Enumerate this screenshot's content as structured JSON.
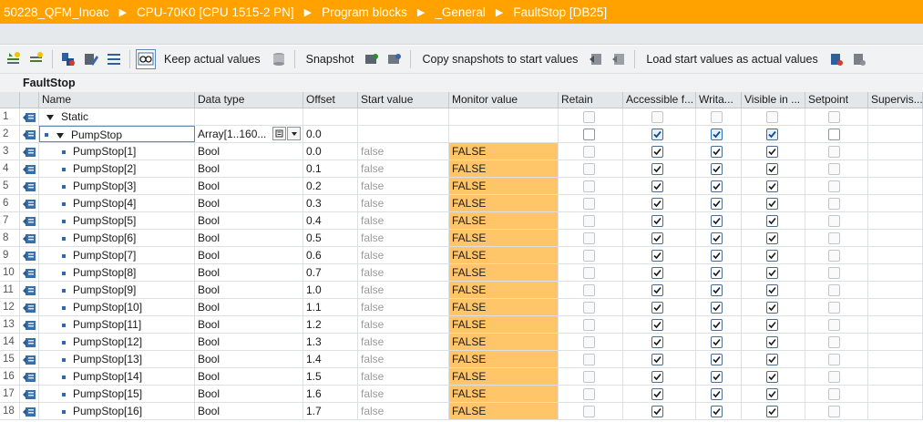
{
  "breadcrumb": [
    "50228_QFM_Inoac",
    "CPU-70K0 [CPU 1515-2 PN]",
    "Program blocks",
    "_General",
    "FaultStop [DB25]"
  ],
  "toolbar": {
    "keep_label": "Keep actual values",
    "snapshot_label": "Snapshot",
    "copy_label": "Copy snapshots to start values",
    "load_label": "Load start values as actual values"
  },
  "block_title": "FaultStop",
  "columns": {
    "name": "Name",
    "type": "Data type",
    "offset": "Offset",
    "start": "Start value",
    "monitor": "Monitor value",
    "retain": "Retain",
    "accessible": "Accessible f...",
    "writable": "Writa...",
    "visible": "Visible in ...",
    "setpoint": "Setpoint",
    "supervision": "Supervis..."
  },
  "rows": [
    {
      "n": "1",
      "name": "Static",
      "type": "",
      "offset": "",
      "start": "",
      "monitor": ""
    },
    {
      "n": "2",
      "name": "PumpStop",
      "type": "Array[1..160...",
      "offset": "0.0",
      "start": "",
      "monitor": ""
    },
    {
      "n": "3",
      "name": "PumpStop[1]",
      "type": "Bool",
      "offset": "0.0",
      "start": "false",
      "monitor": "FALSE"
    },
    {
      "n": "4",
      "name": "PumpStop[2]",
      "type": "Bool",
      "offset": "0.1",
      "start": "false",
      "monitor": "FALSE"
    },
    {
      "n": "5",
      "name": "PumpStop[3]",
      "type": "Bool",
      "offset": "0.2",
      "start": "false",
      "monitor": "FALSE"
    },
    {
      "n": "6",
      "name": "PumpStop[4]",
      "type": "Bool",
      "offset": "0.3",
      "start": "false",
      "monitor": "FALSE"
    },
    {
      "n": "7",
      "name": "PumpStop[5]",
      "type": "Bool",
      "offset": "0.4",
      "start": "false",
      "monitor": "FALSE"
    },
    {
      "n": "8",
      "name": "PumpStop[6]",
      "type": "Bool",
      "offset": "0.5",
      "start": "false",
      "monitor": "FALSE"
    },
    {
      "n": "9",
      "name": "PumpStop[7]",
      "type": "Bool",
      "offset": "0.6",
      "start": "false",
      "monitor": "FALSE"
    },
    {
      "n": "10",
      "name": "PumpStop[8]",
      "type": "Bool",
      "offset": "0.7",
      "start": "false",
      "monitor": "FALSE"
    },
    {
      "n": "11",
      "name": "PumpStop[9]",
      "type": "Bool",
      "offset": "1.0",
      "start": "false",
      "monitor": "FALSE"
    },
    {
      "n": "12",
      "name": "PumpStop[10]",
      "type": "Bool",
      "offset": "1.1",
      "start": "false",
      "monitor": "FALSE"
    },
    {
      "n": "13",
      "name": "PumpStop[11]",
      "type": "Bool",
      "offset": "1.2",
      "start": "false",
      "monitor": "FALSE"
    },
    {
      "n": "14",
      "name": "PumpStop[12]",
      "type": "Bool",
      "offset": "1.3",
      "start": "false",
      "monitor": "FALSE"
    },
    {
      "n": "15",
      "name": "PumpStop[13]",
      "type": "Bool",
      "offset": "1.4",
      "start": "false",
      "monitor": "FALSE"
    },
    {
      "n": "16",
      "name": "PumpStop[14]",
      "type": "Bool",
      "offset": "1.5",
      "start": "false",
      "monitor": "FALSE"
    },
    {
      "n": "17",
      "name": "PumpStop[15]",
      "type": "Bool",
      "offset": "1.6",
      "start": "false",
      "monitor": "FALSE"
    },
    {
      "n": "18",
      "name": "PumpStop[16]",
      "type": "Bool",
      "offset": "1.7",
      "start": "false",
      "monitor": "FALSE"
    }
  ],
  "colors": {
    "accent": "#ffa200",
    "monitor_bg": "#ffc568"
  }
}
